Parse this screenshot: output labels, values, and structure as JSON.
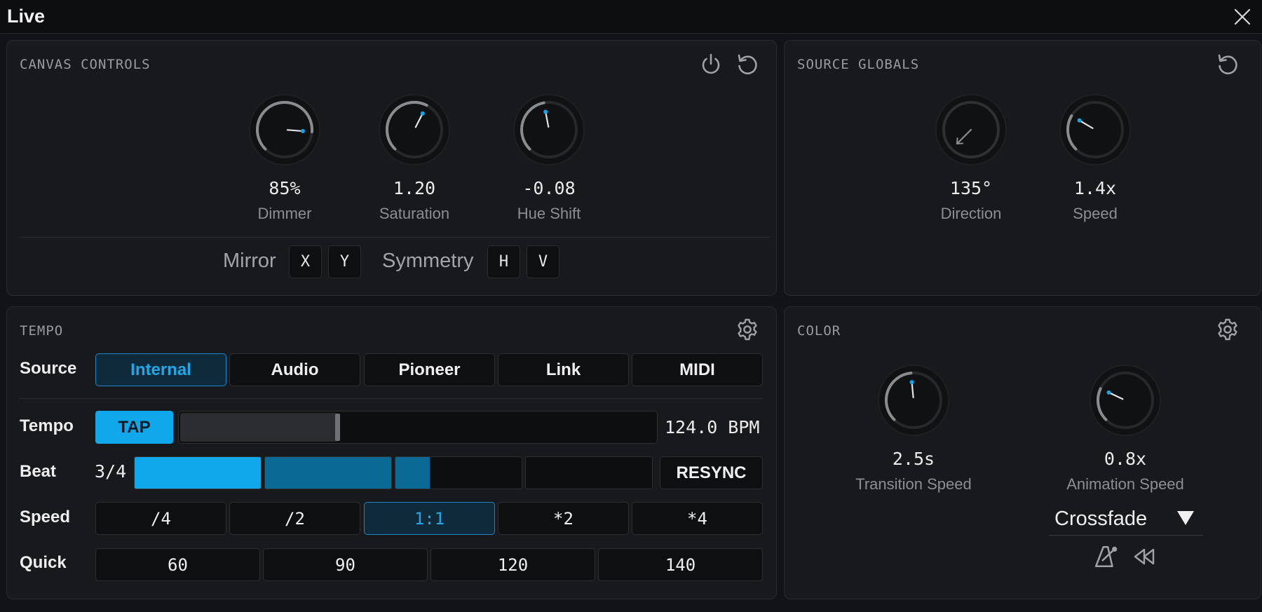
{
  "window": {
    "title": "Live"
  },
  "canvas_controls": {
    "title": "CANVAS CONTROLS",
    "knobs": [
      {
        "value": "85%",
        "label": "Dimmer",
        "level": 0.85
      },
      {
        "value": "1.20",
        "label": "Saturation",
        "level": 0.6
      },
      {
        "value": "-0.08",
        "label": "Hue Shift",
        "level": 0.46
      }
    ],
    "mirror_label": "Mirror",
    "mirror_x": "X",
    "mirror_y": "Y",
    "symmetry_label": "Symmetry",
    "symmetry_h": "H",
    "symmetry_v": "V"
  },
  "source_globals": {
    "title": "SOURCE GLOBALS",
    "knobs": [
      {
        "value": "135°",
        "label": "Direction",
        "level": 0.375
      },
      {
        "value": "1.4x",
        "label": "Speed",
        "level": 0.28
      }
    ]
  },
  "tempo": {
    "title": "TEMPO",
    "source_label": "Source",
    "sources": [
      "Internal",
      "Audio",
      "Pioneer",
      "Link",
      "MIDI"
    ],
    "active_source": "Internal",
    "tempo_label": "Tempo",
    "tap_label": "TAP",
    "tempo_level": 0.33,
    "bpm": "124.0 BPM",
    "beat_label": "Beat",
    "beat_signature": "3/4",
    "beat_fills": [
      1.0,
      1.0,
      0.27,
      0.0,
      0.0
    ],
    "resync_label": "RESYNC",
    "speed_label": "Speed",
    "speeds": [
      "/4",
      "/2",
      "1:1",
      "*2",
      "*4"
    ],
    "active_speed": "1:1",
    "quick_label": "Quick",
    "quick": [
      "60",
      "90",
      "120",
      "140"
    ]
  },
  "color": {
    "title": "COLOR",
    "knobs": [
      {
        "value": "2.5s",
        "label": "Transition Speed",
        "level": 0.48
      },
      {
        "value": "0.8x",
        "label": "Animation Speed",
        "level": 0.26
      }
    ],
    "mode": "Crossfade"
  },
  "colors": {
    "accent": "#10a8ea",
    "beat_dim": "#0b6a93",
    "panel": "#18191c"
  }
}
